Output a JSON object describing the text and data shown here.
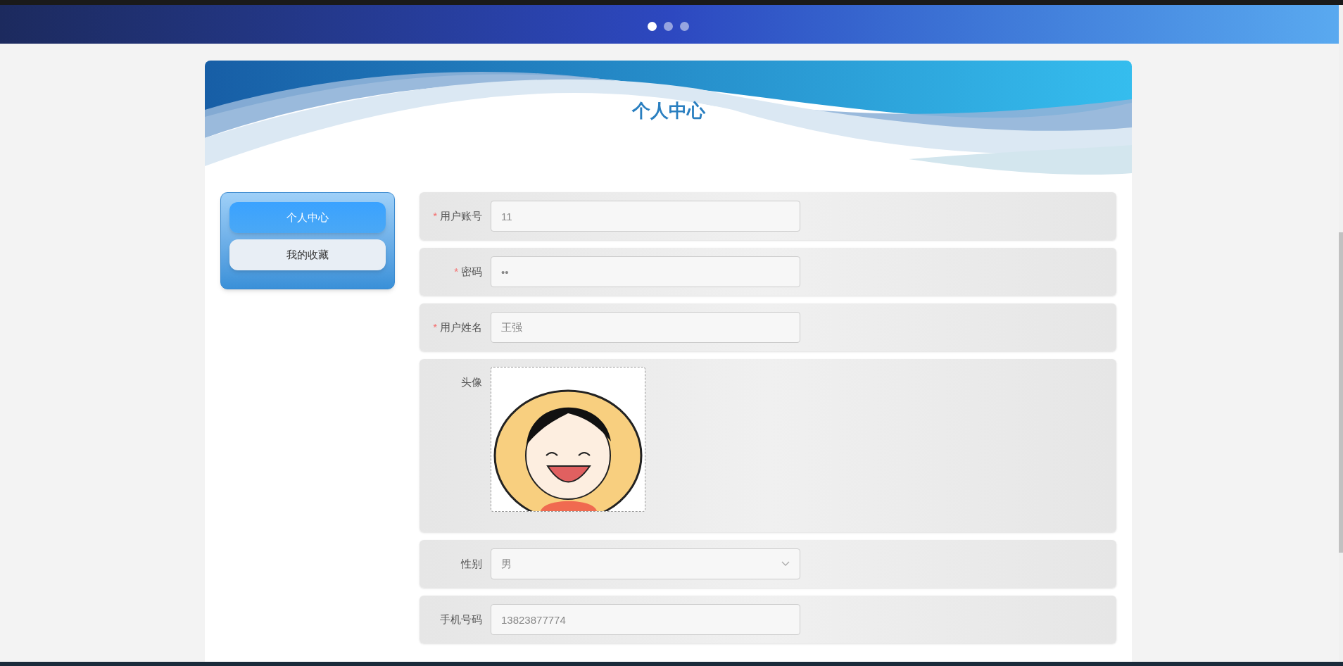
{
  "banner": {
    "dots": [
      {
        "selected": true
      },
      {
        "selected": false
      },
      {
        "selected": false
      }
    ]
  },
  "card": {
    "title": "个人中心"
  },
  "sidebar": {
    "items": [
      {
        "label": "个人中心",
        "selected": true
      },
      {
        "label": "我的收藏",
        "selected": false
      }
    ]
  },
  "form": {
    "fields": [
      {
        "kind": "input",
        "required_mark": "*",
        "label": "用户账号",
        "value": "11"
      },
      {
        "kind": "input",
        "required_mark": "*",
        "label": "密码",
        "value": "••"
      },
      {
        "kind": "input",
        "required_mark": "*",
        "label": "用户姓名",
        "value": "王强"
      },
      {
        "kind": "image",
        "label": "头像"
      },
      {
        "kind": "select",
        "label": "性别",
        "value": "男"
      },
      {
        "kind": "input",
        "label": "手机号码",
        "value": "13823877774"
      }
    ]
  }
}
